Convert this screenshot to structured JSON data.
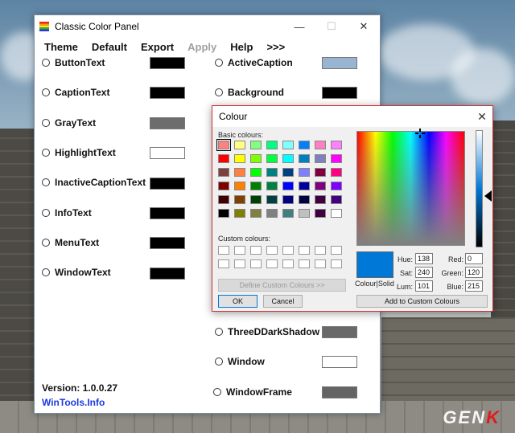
{
  "main_window": {
    "title": "Classic Color Panel",
    "min_symbol": "—",
    "max_symbol": "☐",
    "close_symbol": "✕",
    "menu": [
      "Theme",
      "Default",
      "Export",
      "Apply",
      "Help",
      ">>>"
    ],
    "left_rows": [
      {
        "label": "ButtonText",
        "color": "#000000"
      },
      {
        "label": "CaptionText",
        "color": "#000000"
      },
      {
        "label": "GrayText",
        "color": "#6d6d6d"
      },
      {
        "label": "HighlightText",
        "color": "#ffffff"
      },
      {
        "label": "InactiveCaptionText",
        "color": "#000000"
      },
      {
        "label": "InfoText",
        "color": "#000000"
      },
      {
        "label": "MenuText",
        "color": "#000000"
      },
      {
        "label": "WindowText",
        "color": "#000000"
      }
    ],
    "right_rows_top": [
      {
        "label": "ActiveCaption",
        "color": "#99b4d1"
      },
      {
        "label": "Background",
        "color": "#000000"
      }
    ],
    "right_rows_bottom": [
      {
        "label": "ThreeDDarkShadow",
        "color": "#696969"
      },
      {
        "label": "Window",
        "color": "#ffffff"
      },
      {
        "label": "WindowFrame",
        "color": "#646464"
      }
    ],
    "version": "Version: 1.0.0.27",
    "link": "WinTools.Info"
  },
  "colour_dialog": {
    "title": "Colour",
    "close_symbol": "✕",
    "basic_label": "Basic colours:",
    "custom_label": "Custom colours:",
    "basic_colours": [
      "#ff8080",
      "#ffff80",
      "#80ff80",
      "#00ff80",
      "#80ffff",
      "#0080ff",
      "#ff80c0",
      "#ff80ff",
      "#ff0000",
      "#ffff00",
      "#80ff00",
      "#00ff40",
      "#00ffff",
      "#0080c0",
      "#8080c0",
      "#ff00ff",
      "#804040",
      "#ff8040",
      "#00ff00",
      "#008080",
      "#004080",
      "#8080ff",
      "#800040",
      "#ff0080",
      "#800000",
      "#ff8000",
      "#008000",
      "#008040",
      "#0000ff",
      "#0000a0",
      "#800080",
      "#8000ff",
      "#400000",
      "#804000",
      "#004000",
      "#004040",
      "#000080",
      "#000040",
      "#400040",
      "#400080",
      "#000000",
      "#808000",
      "#808040",
      "#808080",
      "#408080",
      "#c0c0c0",
      "#400040",
      "#ffffff"
    ],
    "selected_basic_index": 0,
    "define_button": "Define Custom Colours >>",
    "ok_button": "OK",
    "cancel_button": "Cancel",
    "add_button": "Add to Custom Colours",
    "solid_label": "Colour|Solid",
    "solid_color": "#0078d7",
    "hue_label": "Hue:",
    "hue": "138",
    "sat_label": "Sat:",
    "sat": "240",
    "lum_label": "Lum:",
    "lum": "101",
    "red_label": "Red:",
    "red": "0",
    "green_label": "Green:",
    "green": "120",
    "blue_label": "Blue:",
    "blue": "215"
  },
  "watermark": {
    "prefix": "GEN",
    "suffix": "K"
  }
}
